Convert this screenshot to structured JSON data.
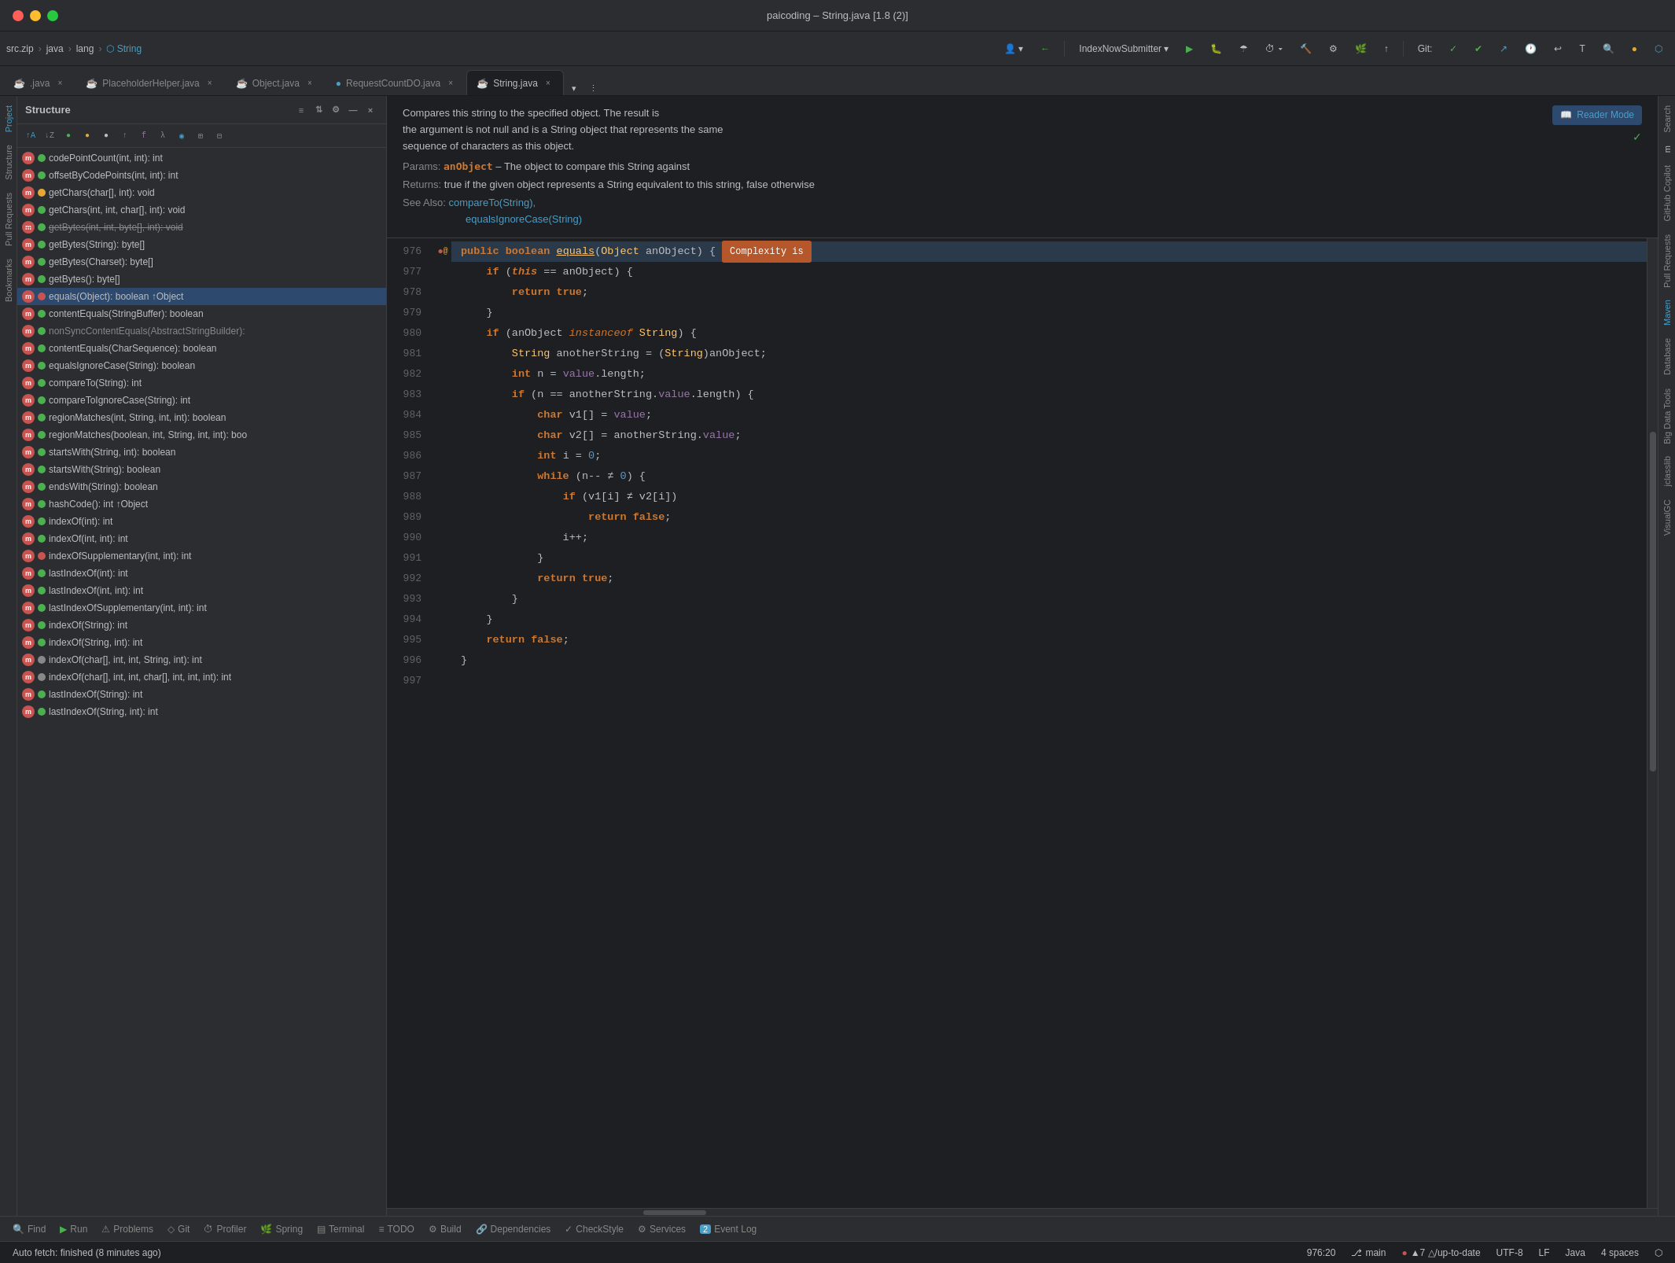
{
  "app": {
    "title": "paicoding – String.java [1.8 (2)]",
    "window_controls": {
      "close": "●",
      "minimize": "●",
      "maximize": "●"
    }
  },
  "breadcrumb": {
    "parts": [
      "src.zip",
      "java",
      "lang",
      "String"
    ]
  },
  "tabs": [
    {
      "id": "java",
      "label": ".java",
      "active": false,
      "modified": false
    },
    {
      "id": "placeholder",
      "label": "PlaceholderHelper.java",
      "active": false,
      "modified": false
    },
    {
      "id": "object",
      "label": "Object.java",
      "active": false,
      "modified": false
    },
    {
      "id": "requestcount",
      "label": "RequestCountDO.java",
      "active": false,
      "modified": false
    },
    {
      "id": "string",
      "label": "String.java",
      "active": true,
      "modified": false
    }
  ],
  "structure_panel": {
    "title": "Structure",
    "items": [
      {
        "badge": "m",
        "badge_color": "pink",
        "access": "green",
        "label": "codePointCount(int, int): int"
      },
      {
        "badge": "m",
        "badge_color": "pink",
        "access": "green",
        "label": "offsetByCodePoints(int, int): int"
      },
      {
        "badge": "m",
        "badge_color": "pink",
        "access": "orange",
        "label": "getChars(char[], int): void"
      },
      {
        "badge": "m",
        "badge_color": "pink",
        "access": "green",
        "label": "getChars(int, int, char[], int): void"
      },
      {
        "badge": "m",
        "badge_color": "pink",
        "access": "green",
        "label": "getBytes(int, int, byte[], int): void",
        "strikethrough": true
      },
      {
        "badge": "m",
        "badge_color": "pink",
        "access": "green",
        "label": "getBytes(String): byte[]"
      },
      {
        "badge": "m",
        "badge_color": "pink",
        "access": "green",
        "label": "getBytes(Charset): byte[]"
      },
      {
        "badge": "m",
        "badge_color": "pink",
        "access": "green",
        "label": "getBytes(): byte[]"
      },
      {
        "badge": "m",
        "badge_color": "pink",
        "access": "red",
        "label": "equals(Object): boolean ↑Object",
        "selected": true
      },
      {
        "badge": "m",
        "badge_color": "pink",
        "access": "green",
        "label": "contentEquals(StringBuffer): boolean"
      },
      {
        "badge": "m",
        "badge_color": "pink",
        "access": "green",
        "label": "nonSyncContentEquals(AbstractStringBuilder):"
      },
      {
        "badge": "m",
        "badge_color": "pink",
        "access": "green",
        "label": "contentEquals(CharSequence): boolean"
      },
      {
        "badge": "m",
        "badge_color": "pink",
        "access": "green",
        "label": "equalsIgnoreCase(String): boolean"
      },
      {
        "badge": "m",
        "badge_color": "pink",
        "access": "green",
        "label": "compareTo(String): int"
      },
      {
        "badge": "m",
        "badge_color": "pink",
        "access": "green",
        "label": "compareToIgnoreCase(String): int"
      },
      {
        "badge": "m",
        "badge_color": "pink",
        "access": "green",
        "label": "regionMatches(int, String, int, int): boolean"
      },
      {
        "badge": "m",
        "badge_color": "pink",
        "access": "green",
        "label": "regionMatches(boolean, int, String, int, int): boo"
      },
      {
        "badge": "m",
        "badge_color": "pink",
        "access": "green",
        "label": "startsWith(String, int): boolean"
      },
      {
        "badge": "m",
        "badge_color": "pink",
        "access": "green",
        "label": "startsWith(String): boolean"
      },
      {
        "badge": "m",
        "badge_color": "pink",
        "access": "green",
        "label": "endsWith(String): boolean"
      },
      {
        "badge": "m",
        "badge_color": "pink",
        "access": "green",
        "label": "hashCode(): int ↑Object"
      },
      {
        "badge": "m",
        "badge_color": "pink",
        "access": "green",
        "label": "indexOf(int): int"
      },
      {
        "badge": "m",
        "badge_color": "pink",
        "access": "green",
        "label": "indexOf(int, int): int"
      },
      {
        "badge": "m",
        "badge_color": "pink",
        "access": "red",
        "label": "indexOfSupplementary(int, int): int"
      },
      {
        "badge": "m",
        "badge_color": "pink",
        "access": "green",
        "label": "lastIndexOf(int): int"
      },
      {
        "badge": "m",
        "badge_color": "pink",
        "access": "green",
        "label": "lastIndexOf(int, int): int"
      },
      {
        "badge": "m",
        "badge_color": "pink",
        "access": "green",
        "label": "lastIndexOfSupplementary(int, int): int"
      },
      {
        "badge": "m",
        "badge_color": "pink",
        "access": "green",
        "label": "indexOf(String): int"
      },
      {
        "badge": "m",
        "badge_color": "pink",
        "access": "green",
        "label": "indexOf(String, int): int"
      },
      {
        "badge": "m",
        "badge_color": "pink",
        "access": "grey",
        "label": "indexOf(char[], int, int, String, int): int"
      },
      {
        "badge": "m",
        "badge_color": "pink",
        "access": "grey",
        "label": "indexOf(char[], int, int, char[], int, int, int): int"
      },
      {
        "badge": "m",
        "badge_color": "pink",
        "access": "green",
        "label": "lastIndexOf(String): int"
      }
    ]
  },
  "doc_panel": {
    "description": "Compares this string to the specified object. The result is the argument is not null and is a String object that represents the same sequence of characters as this object.",
    "params_label": "Params:",
    "param_name": "anObject",
    "param_desc": "– The object to compare this String against",
    "returns_label": "Returns:",
    "returns_desc": "true if the given object represents a String equivalent to this string, false otherwise",
    "see_also_label": "See Also:",
    "see_also_links": [
      "compareTo(String),",
      "equalsIgnoreCase(String)"
    ],
    "reader_mode": "Reader Mode"
  },
  "code": {
    "lines": [
      {
        "num": 976,
        "content": "public boolean equals(Object anObject) {",
        "has_gutter": true,
        "complexity": "Complexity is"
      },
      {
        "num": 977,
        "content": "    if (this == anObject) {"
      },
      {
        "num": 978,
        "content": "        return true;"
      },
      {
        "num": 979,
        "content": "    }"
      },
      {
        "num": 980,
        "content": "    if (anObject instanceof String) {"
      },
      {
        "num": 981,
        "content": "        String anotherString = (String)anObject;"
      },
      {
        "num": 982,
        "content": "        int n = value.length;"
      },
      {
        "num": 983,
        "content": "        if (n == anotherString.value.length) {"
      },
      {
        "num": 984,
        "content": "            char v1[] = value;"
      },
      {
        "num": 985,
        "content": "            char v2[] = anotherString.value;"
      },
      {
        "num": 986,
        "content": "            int i = 0;"
      },
      {
        "num": 987,
        "content": "            while (n-- ≠ 0) {"
      },
      {
        "num": 988,
        "content": "                if (v1[i] ≠ v2[i])"
      },
      {
        "num": 989,
        "content": "                    return false;"
      },
      {
        "num": 990,
        "content": "                i++;"
      },
      {
        "num": 991,
        "content": "            }"
      },
      {
        "num": 992,
        "content": "            return true;"
      },
      {
        "num": 993,
        "content": "        }"
      },
      {
        "num": 994,
        "content": "    }"
      },
      {
        "num": 995,
        "content": "    return false;"
      },
      {
        "num": 996,
        "content": "}"
      },
      {
        "num": 997,
        "content": ""
      }
    ]
  },
  "bottom_toolbar": {
    "items": [
      {
        "icon": "🔍",
        "label": "Find"
      },
      {
        "icon": "▶",
        "label": "Run"
      },
      {
        "icon": "⚠",
        "label": "Problems"
      },
      {
        "icon": "◇",
        "label": "Git"
      },
      {
        "icon": "⏱",
        "label": "Profiler"
      },
      {
        "icon": "🌿",
        "label": "Spring"
      },
      {
        "icon": "▤",
        "label": "Terminal"
      },
      {
        "icon": "≡",
        "label": "TODO"
      },
      {
        "icon": "⚙",
        "label": "Build"
      },
      {
        "icon": "🔗",
        "label": "Dependencies"
      },
      {
        "icon": "✓",
        "label": "CheckStyle"
      },
      {
        "icon": "⚙",
        "label": "Services"
      },
      {
        "icon": "📋",
        "label": "Event Log"
      }
    ]
  },
  "status_bar": {
    "auto_fetch": "Auto fetch: finished (8 minutes ago)",
    "position": "976:20",
    "branch": "main",
    "git_status": "▲7 △/up-to-date",
    "indent": "4 spaces",
    "encoding": "UTF-8",
    "line_separator": "LF",
    "file_type": "Java"
  },
  "right_tools": {
    "items": [
      "Search",
      "GitHub Copilot",
      "Pull Requests",
      "Maven",
      "Database",
      "Big Data Tools",
      "jclasslib",
      "VisualGC"
    ]
  }
}
